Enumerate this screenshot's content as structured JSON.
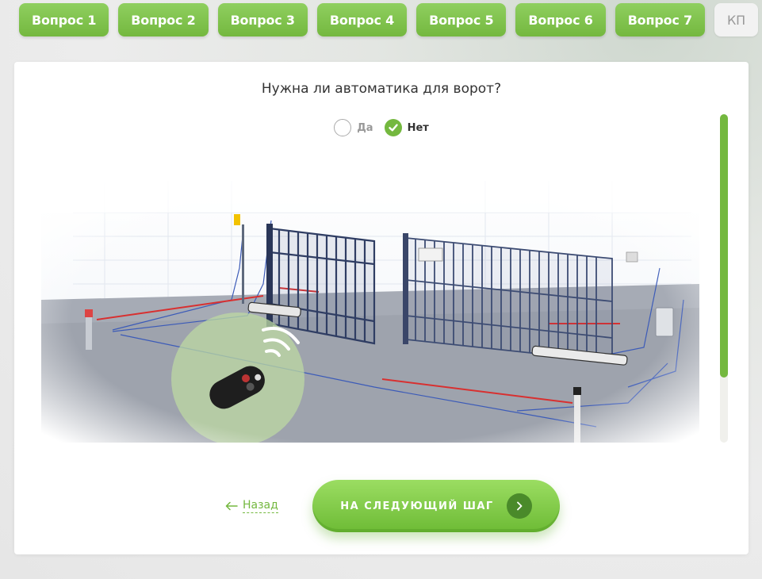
{
  "tabs": [
    {
      "label": "Вопрос 1",
      "state": "done"
    },
    {
      "label": "Вопрос 2",
      "state": "done"
    },
    {
      "label": "Вопрос 3",
      "state": "done"
    },
    {
      "label": "Вопрос 4",
      "state": "done"
    },
    {
      "label": "Вопрос 5",
      "state": "done"
    },
    {
      "label": "Вопрос 6",
      "state": "done"
    },
    {
      "label": "Вопрос 7",
      "state": "done"
    },
    {
      "label": "КП",
      "state": "inactive"
    }
  ],
  "question": {
    "text": "Нужна ли автоматика для ворот?",
    "options": [
      {
        "label": "Да",
        "selected": false
      },
      {
        "label": "Нет",
        "selected": true
      }
    ]
  },
  "navigation": {
    "back_label": "Назад",
    "next_label": "НА СЛЕДУЮЩИЙ ШАГ"
  },
  "colors": {
    "accent": "#74b83f",
    "accent_dark": "#4a8a2a"
  },
  "icons": [
    "check-icon",
    "arrow-left-icon",
    "chevron-right-icon"
  ]
}
